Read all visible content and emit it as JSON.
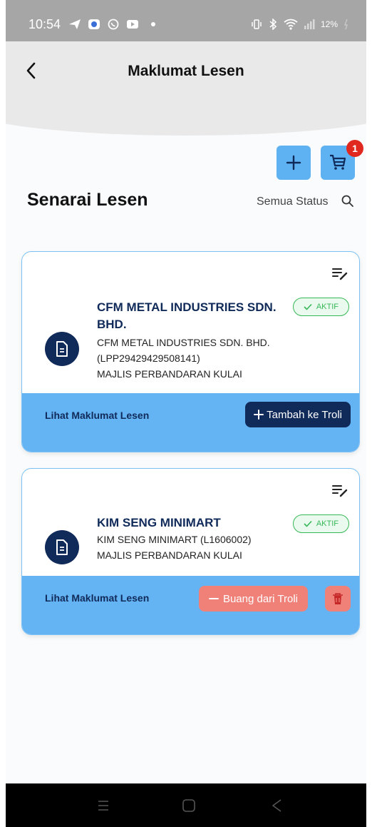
{
  "status_bar": {
    "time": "10:54",
    "battery": "12%"
  },
  "header": {
    "title": "Maklumat Lesen",
    "cart_count": "1"
  },
  "section": {
    "title": "Senarai Lesen",
    "status_filter": "Semua Status"
  },
  "licenses": [
    {
      "name": "CFM METAL INDUSTRIES SDN. BHD.",
      "line1": "CFM METAL INDUSTRIES SDN. BHD.",
      "line2": "(LPP29429429508141)",
      "line3": "MAJLIS PERBANDARAN KULAI",
      "status": "AKTIF",
      "view_label": "Lihat Maklumat Lesen",
      "action_label": "Tambah ke Troli"
    },
    {
      "name": "KIM SENG MINIMART",
      "line1": "KIM SENG MINIMART (L1606002)",
      "line2": "MAJLIS PERBANDARAN KULAI",
      "status": "AKTIF",
      "view_label": "Lihat Maklumat Lesen",
      "action_label": "Buang dari Troli"
    }
  ],
  "colors": {
    "primary": "#102a5a",
    "accent": "#5fb2f1",
    "active": "#36b858",
    "danger": "#f08179",
    "badge": "#e0281f"
  },
  "icons": [
    "send-icon",
    "record-icon",
    "whatsapp-icon",
    "youtube-icon",
    "vibrate-icon",
    "bluetooth-icon",
    "wifi-icon",
    "signal-icon",
    "battery-icon",
    "back-arrow-icon",
    "plus-icon",
    "cart-icon",
    "search-icon",
    "edit-list-icon",
    "document-icon",
    "check-icon",
    "minus-icon",
    "trash-icon",
    "recents-icon",
    "home-icon",
    "nav-back-icon"
  ]
}
